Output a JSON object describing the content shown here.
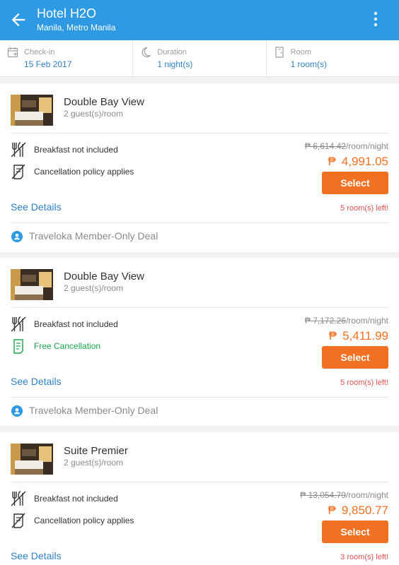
{
  "header": {
    "title": "Hotel H2O",
    "subtitle": "Manila, Metro Manila",
    "back_icon": "arrow-left-icon",
    "menu_icon": "more-vertical-icon",
    "color": "#2f9ae4"
  },
  "summary": {
    "checkin": {
      "label": "Check-in",
      "value": "15 Feb 2017",
      "icon": "calendar-icon"
    },
    "duration": {
      "label": "Duration",
      "value": "1 night(s)",
      "icon": "moon-icon"
    },
    "room": {
      "label": "Room",
      "value": "1 room(s)",
      "icon": "door-icon"
    }
  },
  "rooms": [
    {
      "name": "Double Bay View",
      "guests": "2 guest(s)/room",
      "features": [
        {
          "text": "Breakfast not included",
          "icon": "no-breakfast-icon"
        },
        {
          "text": "Cancellation policy applies",
          "icon": "cancellation-policy-icon"
        }
      ],
      "old_price": "₱ 6,614.42",
      "price_unit": "/room/night",
      "currency": "₱",
      "new_price": "4,991.05",
      "select_label": "Select",
      "see_details": "See Details",
      "rooms_left": "5 room(s) left!",
      "deal": "Traveloka Member-Only Deal"
    },
    {
      "name": "Double Bay View",
      "guests": "2 guest(s)/room",
      "features": [
        {
          "text": "Breakfast not included",
          "icon": "no-breakfast-icon"
        },
        {
          "text": "Free Cancellation",
          "icon": "free-cancellation-icon"
        }
      ],
      "old_price": "₱ 7,172.26",
      "price_unit": "/room/night",
      "currency": "₱",
      "new_price": "5,411.99",
      "select_label": "Select",
      "see_details": "See Details",
      "rooms_left": "5 room(s) left!",
      "deal": "Traveloka Member-Only Deal"
    },
    {
      "name": "Suite Premier",
      "guests": "2 guest(s)/room",
      "features": [
        {
          "text": "Breakfast not included",
          "icon": "no-breakfast-icon"
        },
        {
          "text": "Cancellation policy applies",
          "icon": "cancellation-policy-icon"
        }
      ],
      "old_price": "₱ 13,054.79",
      "price_unit": "/room/night",
      "currency": "₱",
      "new_price": "9,850.77",
      "select_label": "Select",
      "see_details": "See Details",
      "rooms_left": "3 room(s) left!"
    }
  ],
  "colors": {
    "primary": "#2f9ae4",
    "accent": "#f27022",
    "link": "#2f7fc4",
    "warning": "#e05252",
    "success": "#1aa34a"
  }
}
